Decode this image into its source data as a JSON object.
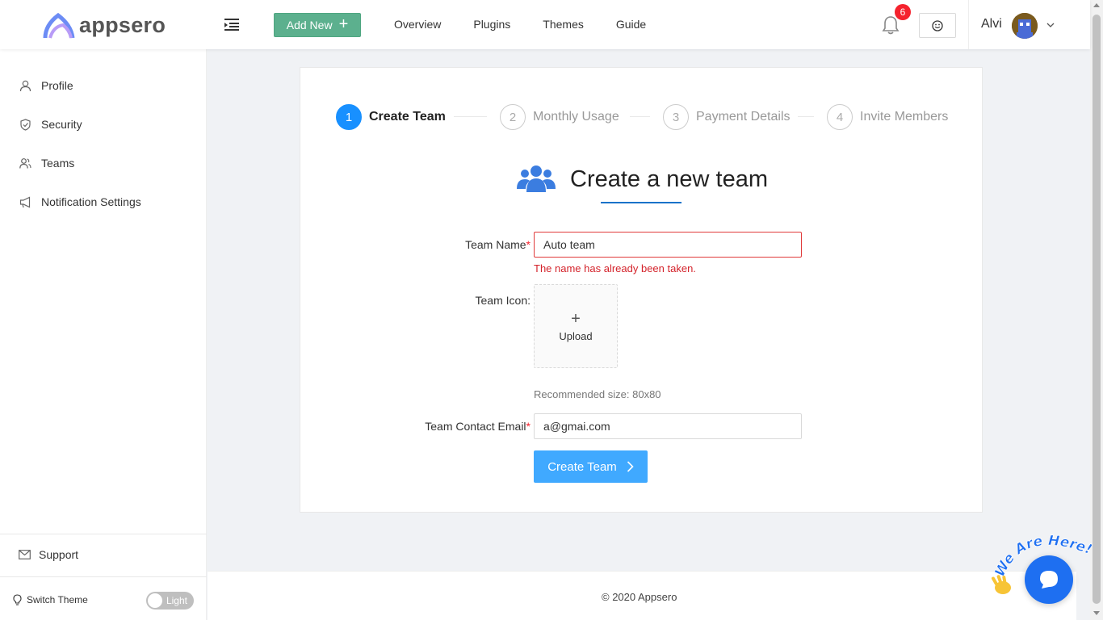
{
  "app": {
    "logo_text": "appsero"
  },
  "header": {
    "add_new_label": "Add New",
    "nav": [
      "Overview",
      "Plugins",
      "Themes",
      "Guide"
    ],
    "notification_count": "6",
    "user_name": "Alvi"
  },
  "sidebar": {
    "items": [
      {
        "label": "Profile",
        "icon": "user-icon"
      },
      {
        "label": "Security",
        "icon": "shield-icon"
      },
      {
        "label": "Teams",
        "icon": "team-icon"
      },
      {
        "label": "Notification Settings",
        "icon": "megaphone-icon"
      }
    ],
    "support_label": "Support",
    "switch_theme_label": "Switch Theme",
    "theme_toggle_label": "Light"
  },
  "steps": [
    {
      "number": "1",
      "label": "Create Team",
      "active": true
    },
    {
      "number": "2",
      "label": "Monthly Usage",
      "active": false
    },
    {
      "number": "3",
      "label": "Payment Details",
      "active": false
    },
    {
      "number": "4",
      "label": "Invite Members",
      "active": false
    }
  ],
  "form": {
    "title": "Create a new team",
    "team_name_label": "Team Name",
    "team_name_value": "Auto team",
    "team_name_error": "The name has already been taken.",
    "team_icon_label": "Team Icon",
    "upload_label": "Upload",
    "recommended_size": "Recommended size: 80x80",
    "email_label": "Team Contact Email",
    "email_value": "a@gmai.com",
    "submit_label": "Create Team"
  },
  "footer": {
    "text": "© 2020 Appsero"
  },
  "chat_widget": {
    "tagline": "We Are Here!"
  },
  "colors": {
    "primary": "#1890ff",
    "add_new": "#5cb08e",
    "error": "#f5222d",
    "chat": "#1e6ff1"
  }
}
